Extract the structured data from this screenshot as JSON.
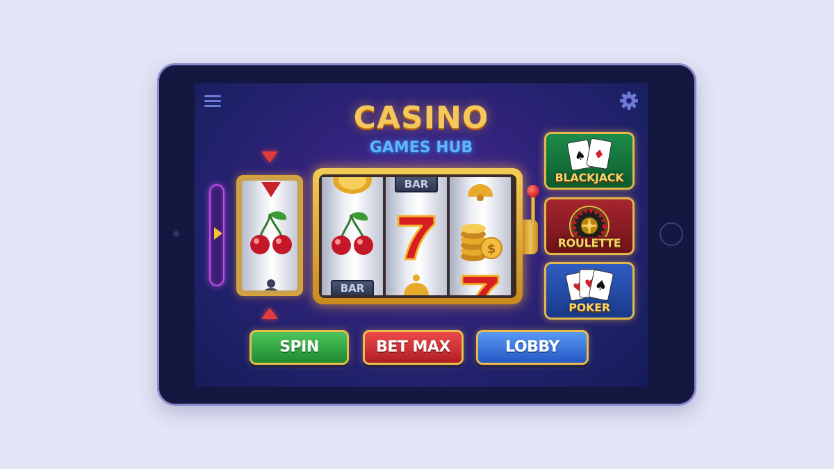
{
  "header": {
    "title": "CASINO",
    "subtitle": "GAMES HUB",
    "menu_icon": "hamburger-menu-icon",
    "settings_icon": "gear-icon"
  },
  "slot_machine": {
    "reel_symbols": [
      "cherries",
      "cherries",
      "seven",
      "gold-coins"
    ],
    "reel_labels": {
      "reel2_top": "BAR",
      "reel1_bottom": "BAR",
      "single_reel_bottom": ""
    },
    "payline_indicator_icon": "triangle-arrow-icon",
    "lever_icon": "lever-icon"
  },
  "games": [
    {
      "label": "BLACKJACK",
      "icon": "playing-cards-icon"
    },
    {
      "label": "ROULETTE",
      "icon": "roulette-wheel-icon"
    },
    {
      "label": "POKER",
      "icon": "playing-cards-icon"
    }
  ],
  "actions": {
    "spin_label": "SPIN",
    "bet_max_label": "BET MAX",
    "lobby_label": "LOBBY"
  },
  "colors": {
    "accent_gold": "#f6c75a",
    "spin_green": "#2ea43f",
    "bet_red": "#d0303a",
    "lobby_blue": "#3f7be0",
    "screen_purple": "#32237c"
  }
}
